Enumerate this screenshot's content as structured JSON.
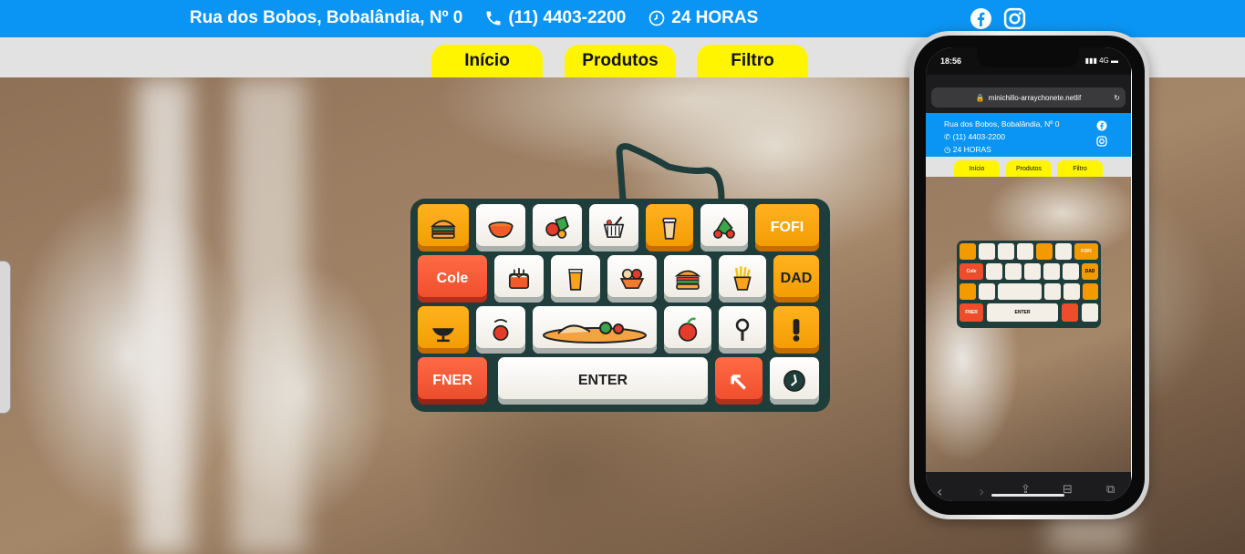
{
  "header": {
    "address": "Rua dos Bobos, Bobalândia, Nº 0",
    "phone": "(11) 4403-2200",
    "hours": "24 HORAS",
    "social_icons": [
      "facebook-icon",
      "instagram-icon"
    ]
  },
  "nav": {
    "items": [
      {
        "label": "Início"
      },
      {
        "label": "Produtos"
      },
      {
        "label": "Filtro"
      }
    ]
  },
  "keyboard": {
    "keys": {
      "fofi": "FOFI",
      "cole": "Cole",
      "dad": "DAD",
      "fner": "FNER",
      "enter": "ENTER"
    }
  },
  "phone_preview": {
    "time": "18:56",
    "network": "4G",
    "url": "minichillo-arraychonete.netlif",
    "address": "Rua dos Bobos, Bobalândia, Nº 0",
    "phone": "(11) 4403-2200",
    "hours": "24 HORAS",
    "nav": [
      "Início",
      "Produtos",
      "Filtro"
    ],
    "keys": {
      "fofi": "FOFI",
      "cole": "Cole",
      "dad": "DAD",
      "fner": "FNER",
      "enter": "ENTER"
    }
  },
  "colors": {
    "topbar": "#0a95f4",
    "navbar": "#e2e2e2",
    "nav_button": "#fff500",
    "keyboard_base": "#1f3d3b",
    "key_orange": "#f29a00",
    "key_red": "#ee4c2b"
  }
}
